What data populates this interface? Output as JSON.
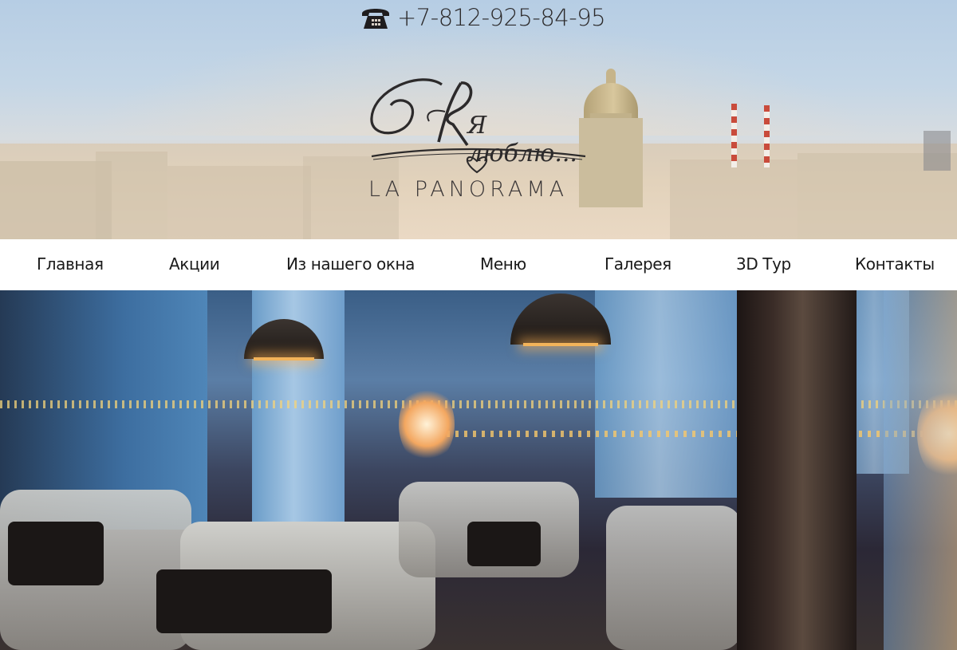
{
  "header": {
    "phone_number": "+7-812-925-84-95",
    "phone_icon": "telephone-icon",
    "logo_script": "Я люблю...",
    "logo_brand": "LA PANORAMA",
    "logo_heart_icon": "heart-icon"
  },
  "nav": {
    "items": [
      {
        "label": "Главная"
      },
      {
        "label": "Акции"
      },
      {
        "label": "Из нашего окна"
      },
      {
        "label": "Меню"
      },
      {
        "label": "Галерея"
      },
      {
        "label": "3D Тур"
      },
      {
        "label": "Контакты"
      }
    ]
  },
  "colors": {
    "nav_background": "#ffffff",
    "nav_text": "#1a1a1a",
    "logo_ink": "#2c2a2b"
  }
}
